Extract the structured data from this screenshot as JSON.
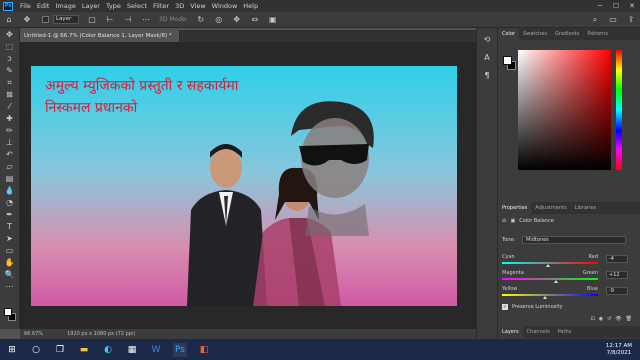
{
  "menu": [
    "File",
    "Edit",
    "Image",
    "Layer",
    "Type",
    "Select",
    "Filter",
    "3D",
    "View",
    "Window",
    "Help"
  ],
  "options": {
    "auto_select_value": "Layer",
    "mode_3d": "3D Mode:"
  },
  "document": {
    "tab_title": "Untitled-1 @ 66.7% (Color Balance 1, Layer Mask/8) *",
    "zoom": "66.67%",
    "dimensions": "1920 px x 1080 px (72 ppi)"
  },
  "canvas": {
    "line1": "अमुल्य म्युजिकको प्रस्तुती र सहकार्यमा",
    "line2": "निस्कमल प्रधानको"
  },
  "color_panel": {
    "tabs": [
      "Color",
      "Swatches",
      "Gradients",
      "Patterns"
    ]
  },
  "properties": {
    "tabs": [
      "Properties",
      "Adjustments",
      "Libraries"
    ],
    "title": "Color Balance",
    "tone_label": "Tone:",
    "tone_value": "Midtones",
    "sliders": [
      {
        "left": "Cyan",
        "right": "Red",
        "value": "-4",
        "position": 0.48
      },
      {
        "left": "Magenta",
        "right": "Green",
        "value": "+12",
        "position": 0.56
      },
      {
        "left": "Yellow",
        "right": "Blue",
        "value": "-9",
        "position": 0.45
      }
    ],
    "preserve_luminosity": "Preserve Luminosity"
  },
  "layers_tabs": [
    "Layers",
    "Channels",
    "Paths"
  ],
  "taskbar": {
    "time": "12:17 AM",
    "date": "7/8/2021"
  },
  "colors": {
    "accent": "#31a8ff",
    "canvas_text": "#e0183a"
  }
}
